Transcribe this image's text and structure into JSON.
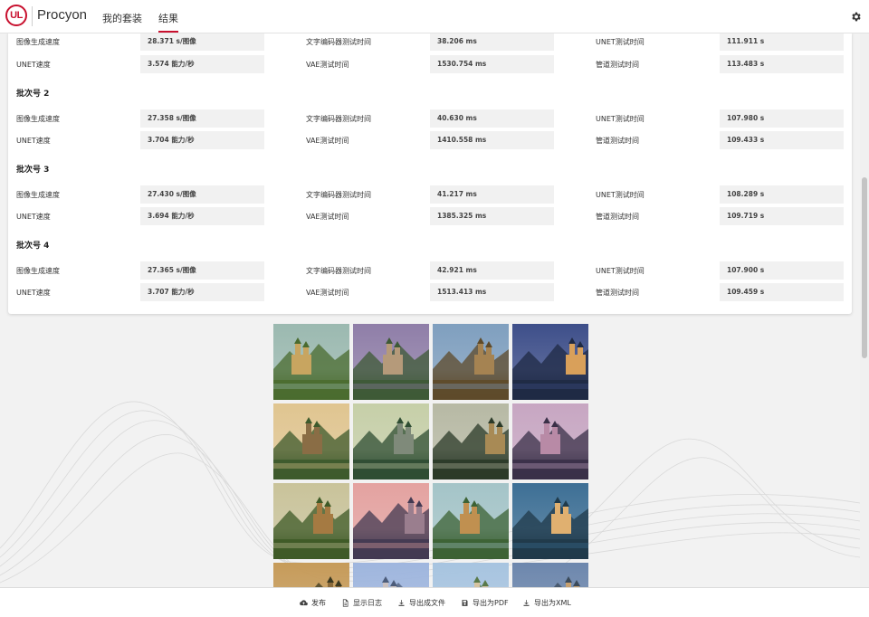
{
  "header": {
    "logo_text": "UL",
    "app_name": "Procyon",
    "nav": [
      "我的套装",
      "结果"
    ],
    "active_nav": "结果"
  },
  "results": {
    "top_rows": [
      [
        {
          "label": "图像生成速度",
          "value": "28.371 s/图像"
        },
        {
          "label": "文字编码器测试时间",
          "value": "38.206 ms"
        },
        {
          "label": "UNET测试时间",
          "value": "111.911 s"
        }
      ],
      [
        {
          "label": "UNET速度",
          "value": "3.574 能力/秒"
        },
        {
          "label": "VAE测试时间",
          "value": "1530.754 ms"
        },
        {
          "label": "管道测试时间",
          "value": "113.483 s"
        }
      ]
    ],
    "batches": [
      {
        "title": "批次号 2",
        "rows": [
          [
            {
              "label": "图像生成速度",
              "value": "27.358 s/图像"
            },
            {
              "label": "文字编码器测试时间",
              "value": "40.630 ms"
            },
            {
              "label": "UNET测试时间",
              "value": "107.980 s"
            }
          ],
          [
            {
              "label": "UNET速度",
              "value": "3.704 能力/秒"
            },
            {
              "label": "VAE测试时间",
              "value": "1410.558 ms"
            },
            {
              "label": "管道测试时间",
              "value": "109.433 s"
            }
          ]
        ]
      },
      {
        "title": "批次号 3",
        "rows": [
          [
            {
              "label": "图像生成速度",
              "value": "27.430 s/图像"
            },
            {
              "label": "文字编码器测试时间",
              "value": "41.217 ms"
            },
            {
              "label": "UNET测试时间",
              "value": "108.289 s"
            }
          ],
          [
            {
              "label": "UNET速度",
              "value": "3.694 能力/秒"
            },
            {
              "label": "VAE测试时间",
              "value": "1385.325 ms"
            },
            {
              "label": "管道测试时间",
              "value": "109.719 s"
            }
          ]
        ]
      },
      {
        "title": "批次号 4",
        "rows": [
          [
            {
              "label": "图像生成速度",
              "value": "27.365 s/图像"
            },
            {
              "label": "文字编码器测试时间",
              "value": "42.921 ms"
            },
            {
              "label": "UNET测试时间",
              "value": "107.900 s"
            }
          ],
          [
            {
              "label": "UNET速度",
              "value": "3.707 能力/秒"
            },
            {
              "label": "VAE测试时间",
              "value": "1513.413 ms"
            },
            {
              "label": "管道测试时间",
              "value": "109.459 s"
            }
          ]
        ]
      }
    ]
  },
  "gallery": {
    "icon": "generated-castle-image",
    "tiles": [
      {
        "sky": "#9bb9b0",
        "ground": "#4a6b2f",
        "castle": "#c8a560"
      },
      {
        "sky": "#8f7ea8",
        "ground": "#3e5a36",
        "castle": "#b59a7a"
      },
      {
        "sky": "#7f9fbf",
        "ground": "#5e4a2a",
        "castle": "#a58352"
      },
      {
        "sky": "#3e4f8a",
        "ground": "#1f2a44",
        "castle": "#d9a05a"
      },
      {
        "sky": "#e0c590",
        "ground": "#3d5a2c",
        "castle": "#8a6d45"
      },
      {
        "sky": "#c6cfa8",
        "ground": "#2f4d33",
        "castle": "#7f8a7a"
      },
      {
        "sky": "#b7b9a4",
        "ground": "#2b3a28",
        "castle": "#a88a55"
      },
      {
        "sky": "#c7a6c2",
        "ground": "#3a3048",
        "castle": "#b88aa6"
      },
      {
        "sky": "#c9c39a",
        "ground": "#3e5a27",
        "castle": "#a57a42"
      },
      {
        "sky": "#e4a2a0",
        "ground": "#433a52",
        "castle": "#9a7e8e"
      },
      {
        "sky": "#a4c4c8",
        "ground": "#3c6234",
        "castle": "#c09050"
      },
      {
        "sky": "#3d6f95",
        "ground": "#203a4a",
        "castle": "#e0b070"
      },
      {
        "sky": "#c69b5a",
        "ground": "#3a3820",
        "castle": "#8a6a3a"
      },
      {
        "sky": "#9fb6de",
        "ground": "#4c5c7a",
        "castle": "#c9c0c0"
      },
      {
        "sky": "#a7c4e0",
        "ground": "#5a7a4a",
        "castle": "#d6c3a0"
      },
      {
        "sky": "#6d87ad",
        "ground": "#3b4a5a",
        "castle": "#c6a070"
      }
    ]
  },
  "footer": {
    "buttons": [
      {
        "label": "发布",
        "icon": "cloud-upload-icon"
      },
      {
        "label": "显示日志",
        "icon": "document-icon"
      },
      {
        "label": "导出成文件",
        "icon": "download-icon"
      },
      {
        "label": "导出为PDF",
        "icon": "save-icon"
      },
      {
        "label": "导出为XML",
        "icon": "download-icon"
      }
    ]
  },
  "colors": {
    "brand_red": "#c8102e",
    "value_bg": "#f1f1f1"
  }
}
